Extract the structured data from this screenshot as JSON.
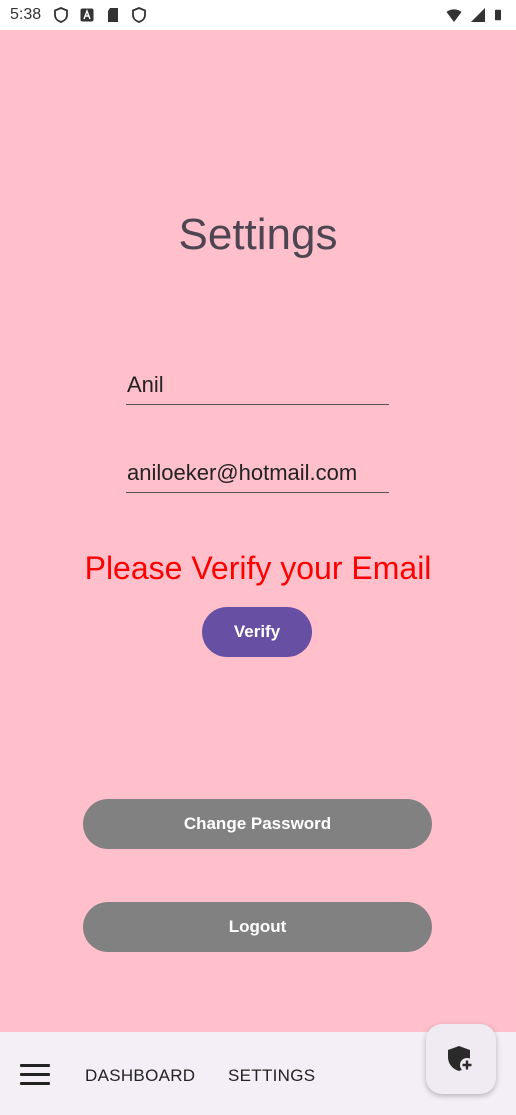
{
  "status_bar": {
    "time": "5:38",
    "left_icons": [
      "shield-icon",
      "a-badge-icon",
      "sd-card-icon",
      "shield-icon"
    ],
    "right_icons": [
      "wifi-icon",
      "cell-signal-icon",
      "battery-icon"
    ]
  },
  "page": {
    "title": "Settings",
    "background": "#ffc0cb"
  },
  "form": {
    "name_value": "Anil",
    "email_value": "aniloeker@hotmail.com"
  },
  "verify": {
    "message": "Please Verify your Email",
    "message_color": "#ff0000",
    "button_label": "Verify",
    "button_color": "#6750a4"
  },
  "actions": {
    "change_password_label": "Change Password",
    "logout_label": "Logout",
    "button_color": "#818181"
  },
  "bottom_nav": {
    "menu_icon": "hamburger-menu-icon",
    "items": [
      {
        "label": "DASHBOARD"
      },
      {
        "label": "SETTINGS"
      }
    ],
    "fab_icon": "shield-add-icon"
  }
}
